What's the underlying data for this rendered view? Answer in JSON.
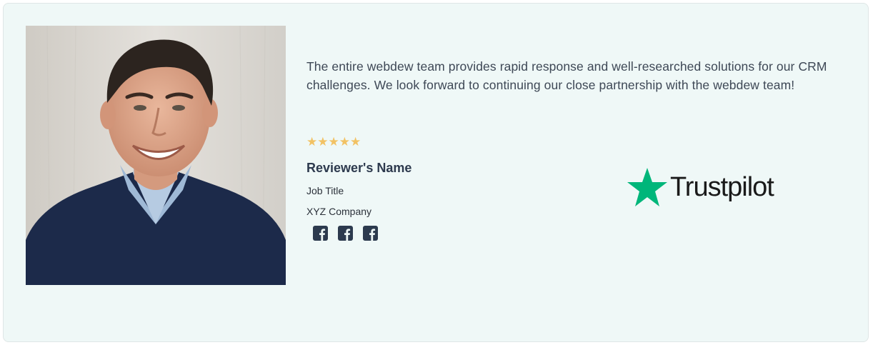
{
  "testimonial": {
    "quote": "The entire webdew team provides rapid response and well-researched solutions for our CRM challenges. We look forward to continuing our close partnership with the webdew team!",
    "rating": 5,
    "stars": "★★★★★",
    "reviewer_name": "Reviewer's Name",
    "job_title": "Job Title",
    "company": "XYZ Company",
    "social_links": [
      {
        "icon": "facebook-icon"
      },
      {
        "icon": "facebook-icon"
      },
      {
        "icon": "facebook-icon"
      }
    ]
  },
  "brand": {
    "name": "Trustpilot",
    "star_color": "#00b67a",
    "icon": "star-icon"
  },
  "colors": {
    "card_background": "#eff8f7",
    "star_rating": "#f2c264",
    "heading": "#2d3a4e"
  }
}
